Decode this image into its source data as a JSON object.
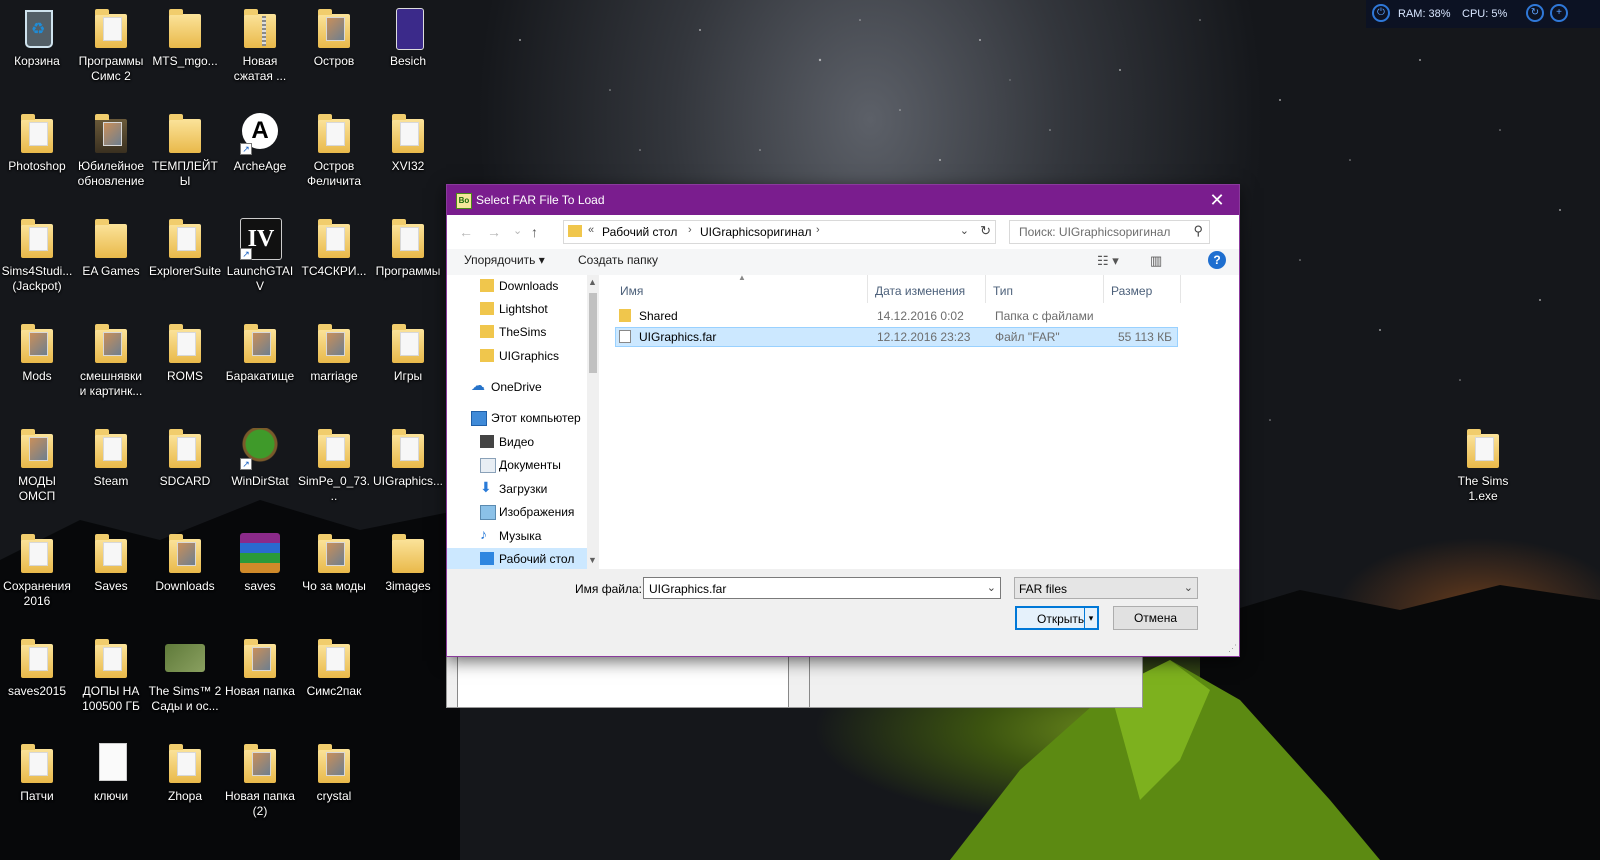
{
  "desktop": {
    "icons": [
      {
        "label": "Корзина"
      },
      {
        "label": "Программы\nСимс 2"
      },
      {
        "label": "MTS_mgo..."
      },
      {
        "label": "Новая\nсжатая ..."
      },
      {
        "label": "Остров"
      },
      {
        "label": "Besich"
      },
      {
        "label": "Photoshop"
      },
      {
        "label": "Юбилейное\nобновление"
      },
      {
        "label": "ТЕМПЛЕЙТЫ"
      },
      {
        "label": "ArcheAge"
      },
      {
        "label": "Остров\nФеличита"
      },
      {
        "label": "XVI32"
      },
      {
        "label": "Sims4Studi...\n(Jackpot)"
      },
      {
        "label": "EA Games"
      },
      {
        "label": "ExplorerSuite"
      },
      {
        "label": "LaunchGTAIV"
      },
      {
        "label": "TC4СКРИ..."
      },
      {
        "label": "Программы"
      },
      {
        "label": "Mods"
      },
      {
        "label": "смешнявки\nи картинк..."
      },
      {
        "label": "ROMS"
      },
      {
        "label": "Баракатище"
      },
      {
        "label": "marriage"
      },
      {
        "label": "Игры"
      },
      {
        "label": "МОДЫ\nОМСП"
      },
      {
        "label": "Steam"
      },
      {
        "label": "SDCARD"
      },
      {
        "label": "WinDirStat"
      },
      {
        "label": "SimPe_0_73..."
      },
      {
        "label": "UIGraphics..."
      },
      {
        "label": "Сохранения\n2016"
      },
      {
        "label": "Saves"
      },
      {
        "label": "Downloads"
      },
      {
        "label": "saves"
      },
      {
        "label": "Чо за моды"
      },
      {
        "label": "3images"
      },
      {
        "label": "saves2015"
      },
      {
        "label": "ДОПЫ НА\n100500 ГБ"
      },
      {
        "label": "The Sims™ 2\nСады и ос..."
      },
      {
        "label": "Новая папка"
      },
      {
        "label": "Симс2пак"
      },
      {
        "label": "Патчи"
      },
      {
        "label": "ключи"
      },
      {
        "label": "Zhopa"
      },
      {
        "label": "Новая папка\n(2)"
      },
      {
        "label": "crystal"
      },
      {
        "label": "The Sims\n1.exe"
      }
    ]
  },
  "tray": {
    "ram": "RAM: 38%",
    "cpu": "CPU: 5%"
  },
  "dialog": {
    "title": "Select FAR File To Load",
    "close": "✕",
    "nav": {
      "back": "←",
      "forward": "→",
      "recent": "⌄",
      "up": "↑"
    },
    "address": {
      "prefix": "«",
      "crumbs": [
        "Рабочий стол",
        "UIGraphicsоригинал"
      ],
      "sep": "›"
    },
    "search_placeholder": "Поиск: UIGraphicsоригинал",
    "toolbar": {
      "organize": "Упорядочить ▾",
      "new_folder": "Создать папку"
    },
    "nav_pane": [
      "Downloads",
      "Lightshot",
      "TheSims",
      "UIGraphics",
      "OneDrive",
      "Этот компьютер",
      "Видео",
      "Документы",
      "Загрузки",
      "Изображения",
      "Музыка",
      "Рабочий стол"
    ],
    "columns": {
      "name": "Имя",
      "date": "Дата изменения",
      "type": "Тип",
      "size": "Размер"
    },
    "files": [
      {
        "name": "Shared",
        "date": "14.12.2016 0:02",
        "type": "Папка с файлами",
        "size": ""
      },
      {
        "name": "UIGraphics.far",
        "date": "12.12.2016 23:23",
        "type": "Файл \"FAR\"",
        "size": "55 113 КБ"
      }
    ],
    "filename_label": "Имя файла:",
    "filename_value": "UIGraphics.far",
    "filetype": "FAR files",
    "open_button": "Открыть",
    "cancel_button": "Отмена"
  }
}
